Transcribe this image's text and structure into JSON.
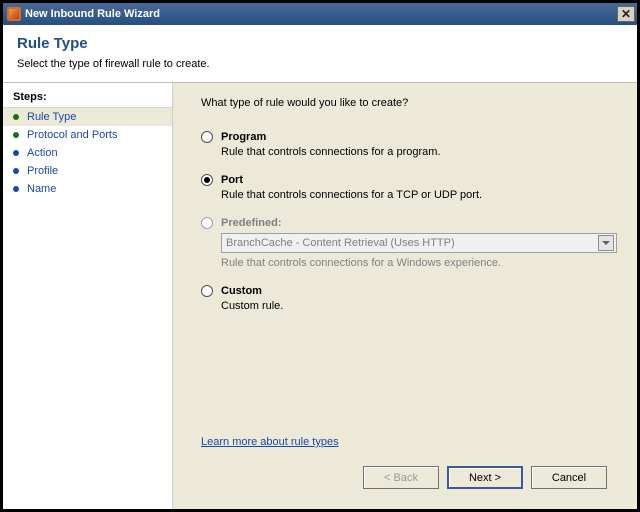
{
  "window": {
    "title": "New Inbound Rule Wizard"
  },
  "header": {
    "title": "Rule Type",
    "subtitle": "Select the type of firewall rule to create."
  },
  "steps": {
    "label": "Steps:",
    "items": [
      {
        "label": "Rule Type",
        "state": "current"
      },
      {
        "label": "Protocol and Ports",
        "state": "current"
      },
      {
        "label": "Action",
        "state": "pending"
      },
      {
        "label": "Profile",
        "state": "pending"
      },
      {
        "label": "Name",
        "state": "pending"
      }
    ]
  },
  "content": {
    "prompt": "What type of rule would you like to create?",
    "options": [
      {
        "id": "program",
        "label": "Program",
        "desc": "Rule that controls connections for a program.",
        "checked": false,
        "enabled": true
      },
      {
        "id": "port",
        "label": "Port",
        "desc": "Rule that controls connections for a TCP or UDP port.",
        "checked": true,
        "enabled": true
      },
      {
        "id": "predefined",
        "label": "Predefined:",
        "desc": "Rule that controls connections for a Windows experience.",
        "checked": false,
        "enabled": false,
        "dropdown": "BranchCache - Content Retrieval (Uses HTTP)"
      },
      {
        "id": "custom",
        "label": "Custom",
        "desc": "Custom rule.",
        "checked": false,
        "enabled": true
      }
    ],
    "learn_link": "Learn more about rule types"
  },
  "buttons": {
    "back": "< Back",
    "next": "Next >",
    "cancel": "Cancel"
  }
}
